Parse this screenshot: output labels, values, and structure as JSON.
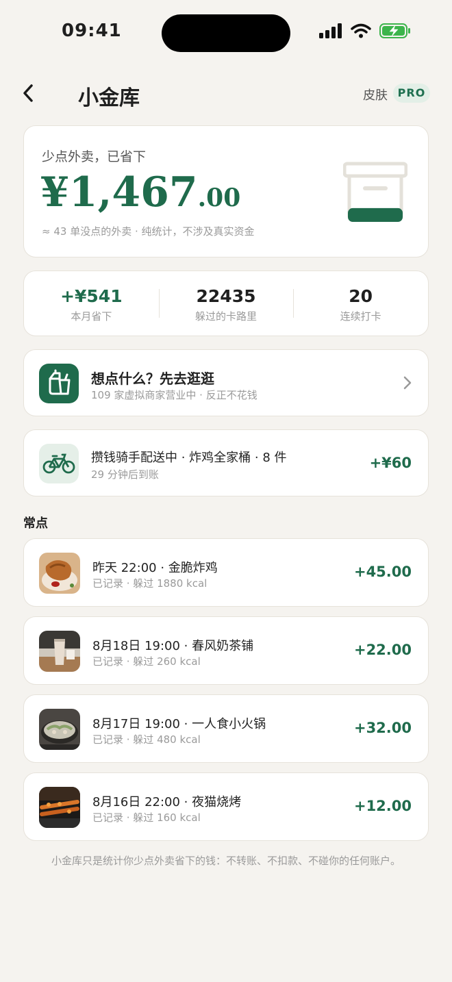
{
  "status": {
    "time": "09:41"
  },
  "nav": {
    "title": "小金库",
    "skin_label": "皮肤",
    "pro_badge": "PRO"
  },
  "hero": {
    "label": "少点外卖，已省下",
    "amount_int": "¥1,467",
    "amount_dec": ".00",
    "sub": "≈ 43 单没点的外卖 · 纯统计，不涉及真实资金",
    "fill_fraction": 0.3
  },
  "stats": [
    {
      "value": "+¥541",
      "label": "本月省下"
    },
    {
      "value": "22435",
      "label": "躲过的卡路里"
    },
    {
      "value": "20",
      "label": "连续打卡"
    }
  ],
  "browse": {
    "title": "想点什么？先去逛逛",
    "subtitle": "109 家虚拟商家营业中 · 反正不花钱"
  },
  "rider": {
    "title": "攒钱骑手配送中 · 炸鸡全家桶 · 8 件",
    "subtitle": "29 分钟后到账",
    "amount": "+¥60"
  },
  "section": {
    "title": "常点"
  },
  "orders": [
    {
      "title": "昨天 22:00 · 金脆炸鸡",
      "subtitle": "已记录 · 躲过 1880 kcal",
      "amount": "+45.00"
    },
    {
      "title": "8月18日 19:00 · 春风奶茶铺",
      "subtitle": "已记录 · 躲过 260 kcal",
      "amount": "+22.00"
    },
    {
      "title": "8月17日 19:00 · 一人食小火锅",
      "subtitle": "已记录 · 躲过 480 kcal",
      "amount": "+32.00"
    },
    {
      "title": "8月16日 22:00 · 夜猫烧烤",
      "subtitle": "已记录 · 躲过 160 kcal",
      "amount": "+12.00"
    }
  ],
  "footer": "小金库只是统计你少点外卖省下的钱：不转账、不扣款、不碰你的任何账户。",
  "colors": {
    "accent": "#1f6b4c",
    "background": "#f5f3ef",
    "card": "#ffffff",
    "muted": "#9a9a9a"
  }
}
